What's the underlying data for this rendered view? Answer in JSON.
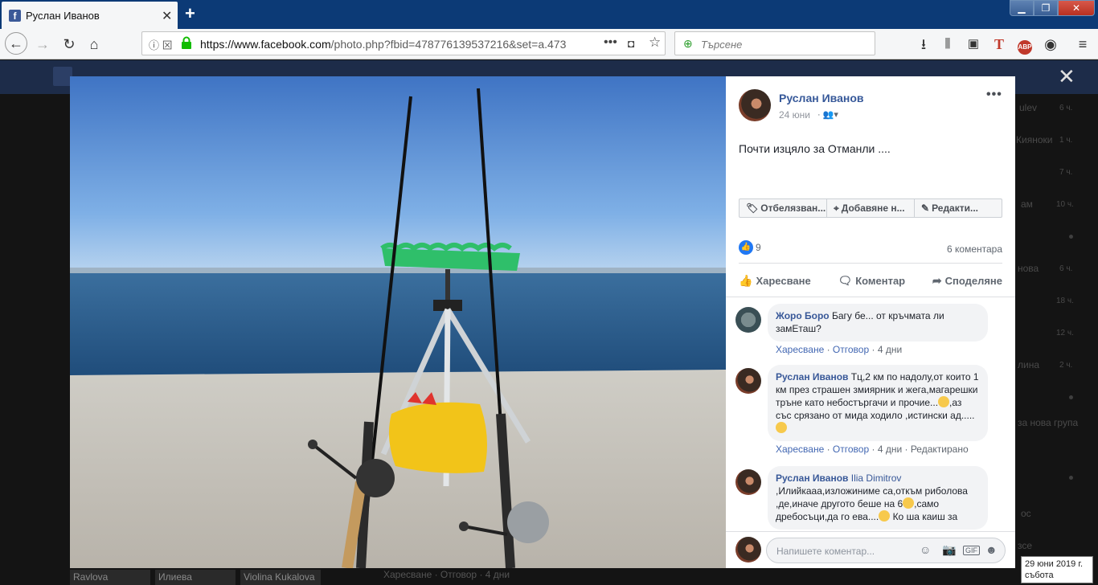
{
  "browser": {
    "tab_title": "Руслан Иванов",
    "url_domain": "https://www.facebook.com",
    "url_path": "/photo.php?fbid=478776139537216&set=a.473",
    "search_placeholder": "Търсене"
  },
  "post": {
    "author": "Руслан Иванов",
    "date": "24 юни",
    "caption": "Почти изцяло за Отманли ....",
    "actions": [
      {
        "label": "Отбелязван..."
      },
      {
        "label": "Добавяне н..."
      },
      {
        "label": "Редакти..."
      }
    ],
    "like_count": "9",
    "comment_count": "6 коментара",
    "ufi": {
      "like": "Харесване",
      "comment": "Коментар",
      "share": "Споделяне"
    }
  },
  "comments": [
    {
      "author": "Жоро Боро",
      "text": "Багу бе... от кръчмата ли замЕташ?",
      "like": "Харесване",
      "reply": "Отговор",
      "time": "4 дни"
    },
    {
      "author": "Руслан Иванов",
      "text_1": "Тц,2 км по надолу,от които 1 км през страшен змиярник и жега,магарешки тръне като небостъргачи и прочие...",
      "text_2": ",аз със срязано от мида ходило ,истински ад.....",
      "like": "Харесване",
      "reply": "Отговор",
      "time": "4 дни",
      "edited": "Редактирано"
    },
    {
      "author": "Руслан Иванов",
      "tag": "Ilia Dimitrov",
      "text_1": ",Илийкааа,изложиниме са,откъм риболова ,де,иначе другото беше на 6",
      "text_2": ",само дребосъци,да го ева....",
      "text_3": " Ко ша каиш за"
    }
  ],
  "composer": {
    "placeholder": "Напишете коментар..."
  },
  "tooltip": {
    "line1": "29 юни 2019 г.",
    "line2": "събота"
  },
  "background": {
    "names": [
      "Ravlova",
      "Илиева",
      "Violina Kukalova"
    ],
    "bottom_line": "Харесване · Отговор · 4 дни",
    "right_items": [
      "ulev",
      "Кияноки",
      "ам",
      "нова",
      "лина",
      "за нова група",
      "ос",
      "зсе"
    ],
    "right_counts": [
      "6 ч.",
      "1 ч.",
      "7 ч.",
      "10 ч.",
      "6 ч.",
      "18 ч.",
      "12 ч.",
      "2 ч."
    ]
  },
  "colors": {
    "fb_blue": "#3b5998",
    "link": "#385898",
    "tab_bg": "#0c3a76"
  }
}
